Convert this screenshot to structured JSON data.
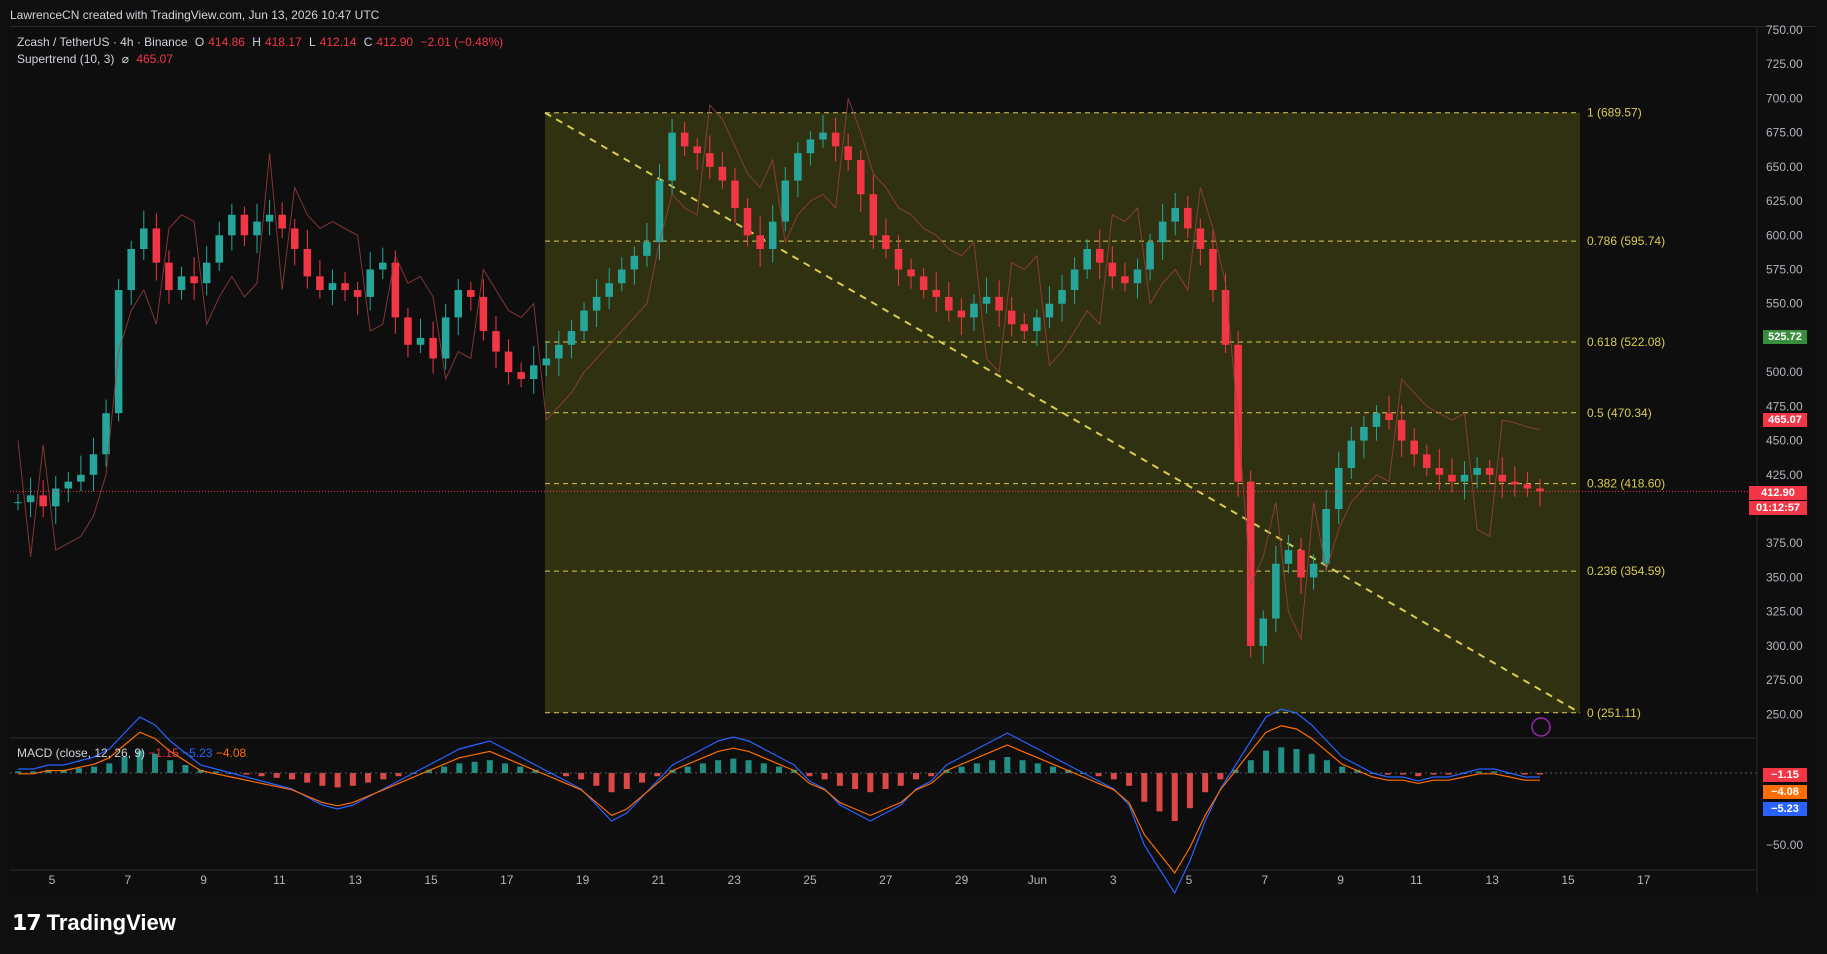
{
  "credit": "LawrenceCN created with TradingView.com, Jun 13, 2026 10:47 UTC",
  "legend": {
    "symbol": "Zcash / TetherUS · 4h · Binance",
    "o_label": "O",
    "o": "414.86",
    "h_label": "H",
    "h": "418.17",
    "l_label": "L",
    "l": "412.14",
    "c_label": "C",
    "c": "412.90",
    "change": "−2.01 (−0.48%)",
    "supertrend": "Supertrend (10, 3)",
    "supertrend_value": "465.07"
  },
  "macd_legend": {
    "name": "MACD (close, 12, 26, 9)",
    "v1": "−1.15",
    "v2": "−5.23",
    "v3": "−4.08"
  },
  "badges": {
    "green_level": "525.72",
    "supertrend": "465.07",
    "price": "412.90",
    "countdown": "01:12:57",
    "macd1": "−1.15",
    "macd2": "−4.08",
    "macd3": "−5.23",
    "macd_axis": "−50.00"
  },
  "colors": {
    "up": "#26a69a",
    "down": "#f23645",
    "fib": "#d9cc52",
    "fib_fill": "#3b3d12",
    "st_up": "#4caf50",
    "st_down": "#f23645",
    "macd": "#2962ff",
    "signal": "#ff6d00"
  },
  "footer": {
    "brand": "TradingView"
  },
  "chart_data": {
    "type": "candlestick",
    "title": "Zcash / TetherUS · 4h · Binance",
    "y_ticks": [
      "750.00",
      "725.00",
      "700.00",
      "675.00",
      "650.00",
      "625.00",
      "600.00",
      "575.00",
      "550.00",
      "525.00",
      "500.00",
      "475.00",
      "450.00",
      "425.00",
      "400.00",
      "375.00",
      "350.00",
      "325.00",
      "300.00",
      "275.00",
      "250.00"
    ],
    "ylim": [
      240,
      750
    ],
    "x_ticks": [
      "5",
      "7",
      "9",
      "11",
      "13",
      "15",
      "17",
      "19",
      "21",
      "23",
      "25",
      "27",
      "29",
      "Jun",
      "3",
      "5",
      "7",
      "9",
      "11",
      "13",
      "15",
      "17"
    ],
    "fib_levels": [
      {
        "label": "1 (689.57)",
        "value": 689.57
      },
      {
        "label": "0.786 (595.74)",
        "value": 595.74
      },
      {
        "label": "0.618 (522.08)",
        "value": 522.08
      },
      {
        "label": "0.5 (470.34)",
        "value": 470.34
      },
      {
        "label": "0.382 (418.60)",
        "value": 418.6
      },
      {
        "label": "0.236 (354.59)",
        "value": 354.59
      },
      {
        "label": "0 (251.11)",
        "value": 251.11
      }
    ],
    "closes": [
      405,
      410,
      402,
      415,
      420,
      425,
      440,
      470,
      560,
      590,
      605,
      580,
      560,
      570,
      565,
      580,
      600,
      615,
      600,
      610,
      615,
      605,
      590,
      570,
      560,
      565,
      560,
      555,
      575,
      580,
      540,
      520,
      525,
      510,
      540,
      560,
      555,
      530,
      515,
      500,
      495,
      505,
      510,
      520,
      530,
      545,
      555,
      565,
      575,
      585,
      595,
      640,
      675,
      665,
      660,
      650,
      640,
      620,
      600,
      590,
      610,
      640,
      660,
      670,
      675,
      665,
      655,
      630,
      600,
      590,
      575,
      570,
      560,
      555,
      545,
      540,
      550,
      555,
      545,
      535,
      530,
      540,
      550,
      560,
      575,
      590,
      580,
      570,
      565,
      575,
      595,
      610,
      620,
      605,
      590,
      560,
      520,
      420,
      300,
      320,
      360,
      370,
      350,
      360,
      400,
      430,
      450,
      460,
      470,
      465,
      450,
      440,
      430,
      425,
      420,
      425,
      430,
      425,
      420,
      418,
      415,
      413
    ],
    "macd_hist": [
      1,
      1,
      2,
      2,
      3,
      4,
      6,
      10,
      14,
      12,
      8,
      5,
      2,
      1,
      0,
      -1,
      -2,
      -3,
      -4,
      -6,
      -8,
      -9,
      -8,
      -6,
      -4,
      -2,
      0,
      2,
      4,
      6,
      7,
      8,
      6,
      4,
      2,
      0,
      -2,
      -4,
      -8,
      -12,
      -10,
      -6,
      -2,
      2,
      4,
      6,
      8,
      9,
      8,
      6,
      4,
      2,
      -2,
      -4,
      -8,
      -10,
      -12,
      -10,
      -8,
      -4,
      -2,
      2,
      4,
      6,
      8,
      10,
      8,
      6,
      4,
      2,
      0,
      -2,
      -4,
      -8,
      -18,
      -24,
      -30,
      -22,
      -12,
      -4,
      2,
      8,
      14,
      16,
      15,
      12,
      8,
      4,
      2,
      0,
      -1,
      -1,
      -2,
      -1,
      -1,
      0,
      1,
      1,
      0,
      -1,
      -1
    ]
  }
}
